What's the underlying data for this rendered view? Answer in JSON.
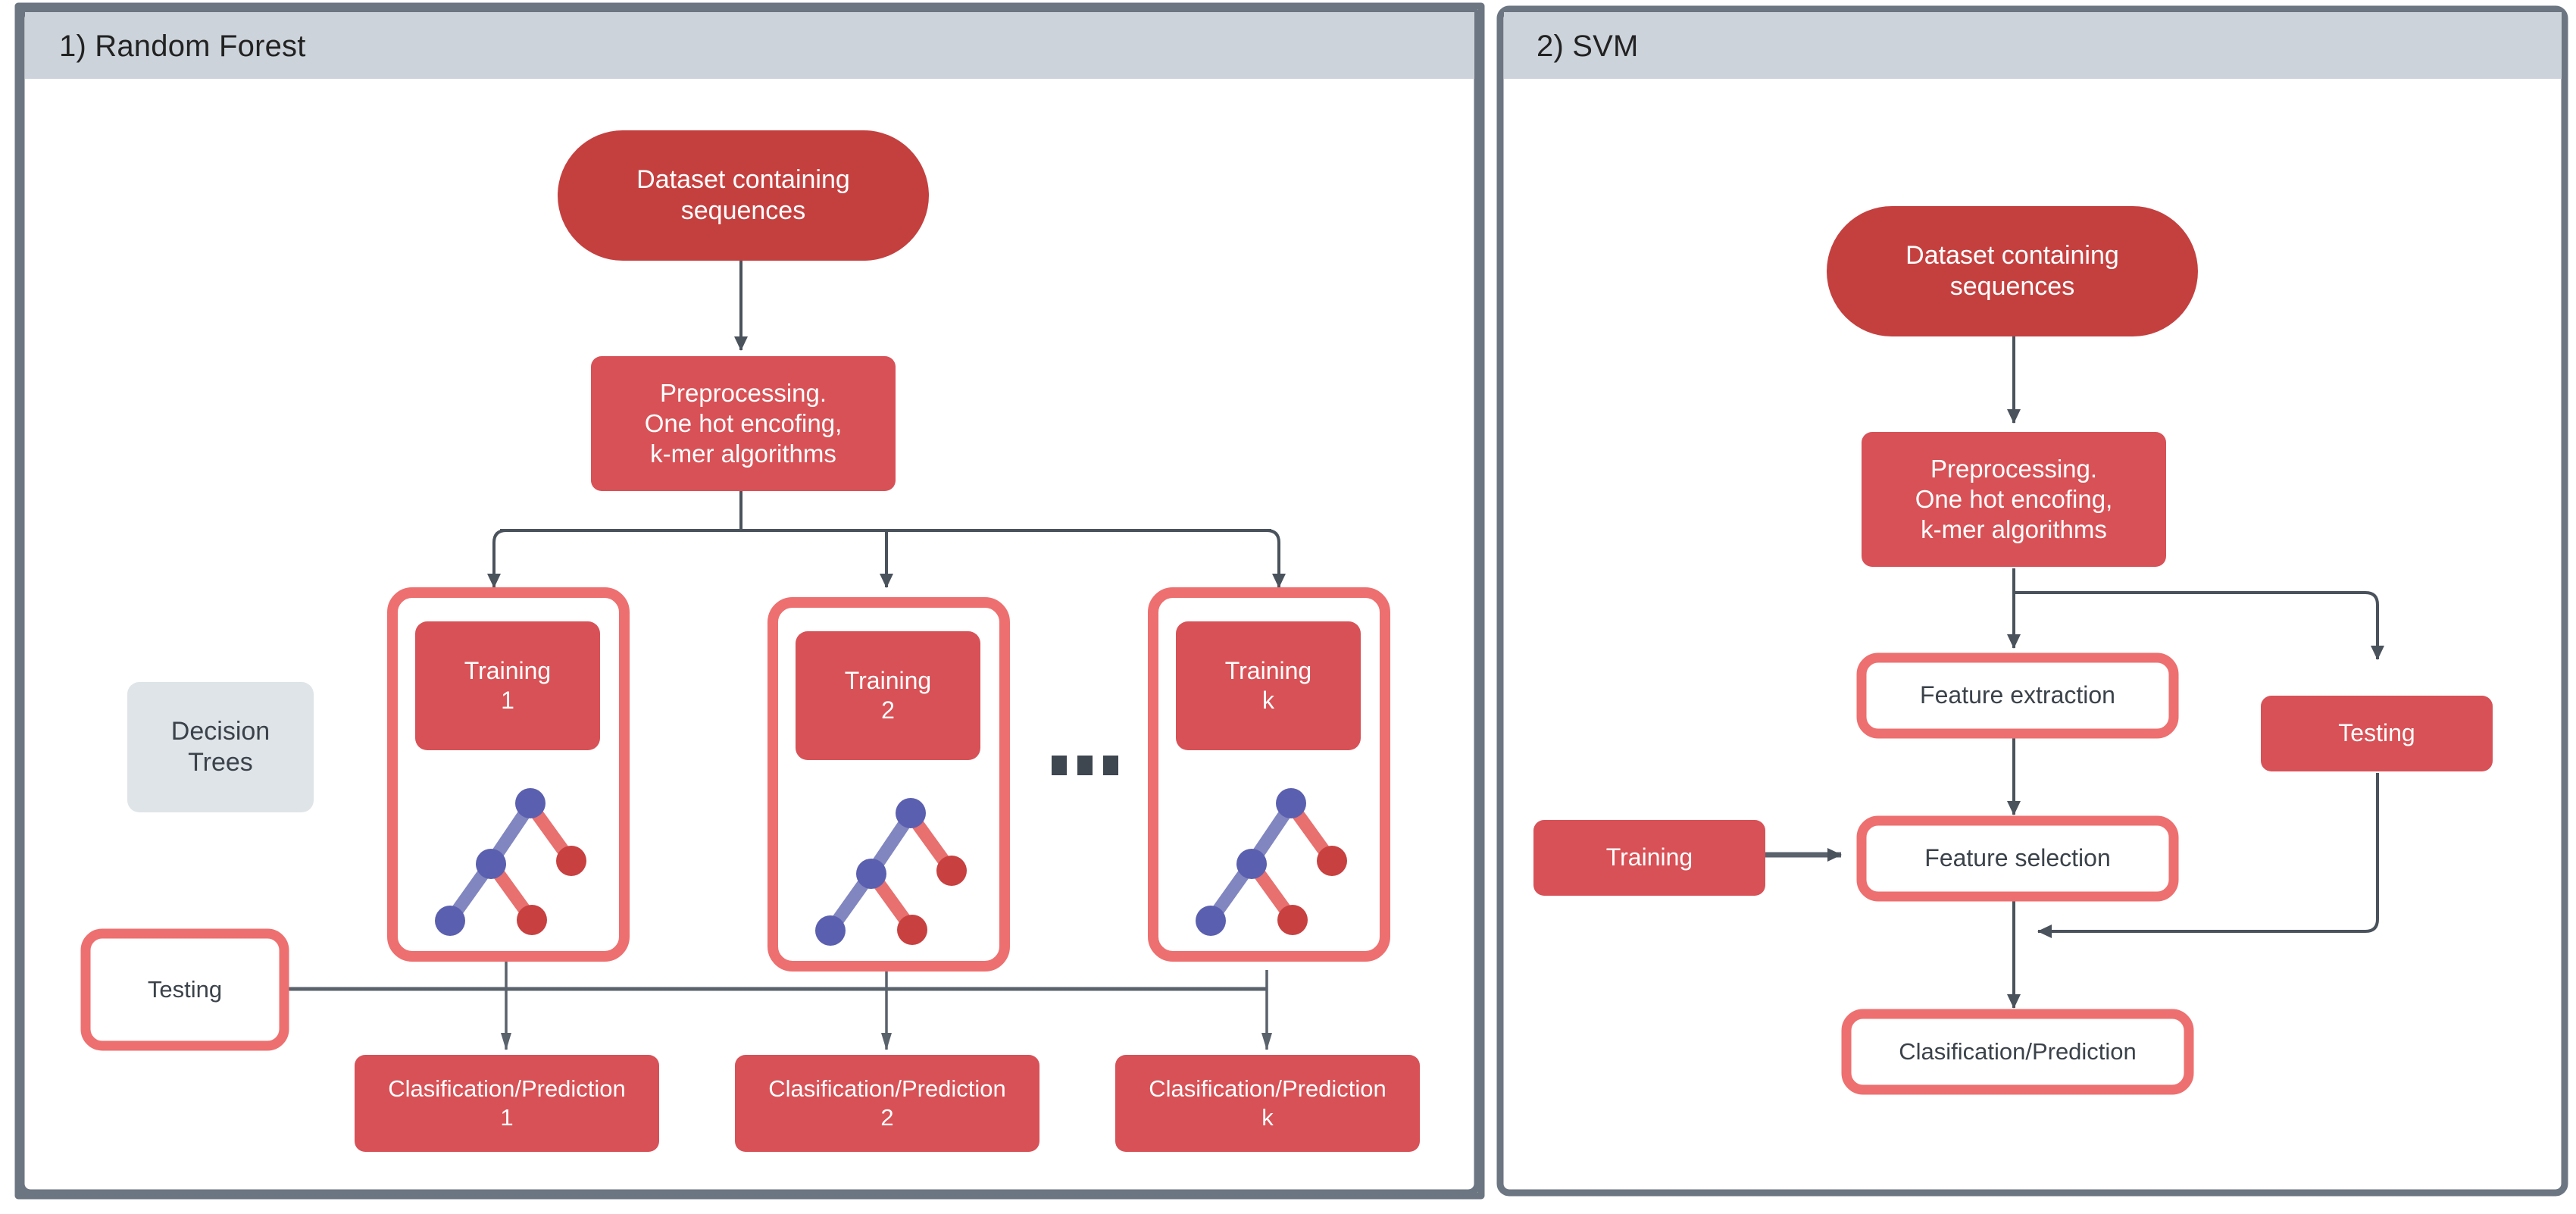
{
  "panels": [
    {
      "id": "random-forest",
      "title": "1) Random Forest"
    },
    {
      "id": "svm",
      "title": "2) SVM"
    }
  ],
  "colors": {
    "panel_border": "#6C7682",
    "panel_header_bg": "#CCD3DA",
    "node_dark_red": "#C4403F",
    "node_light_red": "#D85156",
    "node_outline_red": "#EE6F6F",
    "grey_box_bg": "#DEE4E8",
    "edge": "#4A525C",
    "tree_blue": "#5B5FAF",
    "tree_red": "#D4504F",
    "text_white": "#FFFFFF",
    "text_dark": "#3B424A",
    "canvas_bg": "#FFFFFF"
  },
  "random_forest": {
    "dataset": "Dataset containing\nsequences",
    "preprocessing": "Preprocessing.\nOne hot encofing,\nk-mer algorithms",
    "decision_trees_label": "Decision\nTrees",
    "testing": "Testing",
    "ellipsis": "■ ■ ■",
    "trainings": [
      {
        "label": "Training\n1"
      },
      {
        "label": "Training\n2"
      },
      {
        "label": "Training\nk"
      }
    ],
    "predictions": [
      {
        "label": "Clasification/Prediction\n1"
      },
      {
        "label": "Clasification/Prediction\n2"
      },
      {
        "label": "Clasification/Prediction\nk"
      }
    ]
  },
  "svm": {
    "dataset": "Dataset containing\nsequences",
    "preprocessing": "Preprocessing.\nOne hot encofing,\nk-mer algorithms",
    "feature_extraction": "Feature extraction",
    "testing": "Testing",
    "training": "Training",
    "feature_selection": "Feature selection",
    "prediction": "Clasification/Prediction"
  }
}
